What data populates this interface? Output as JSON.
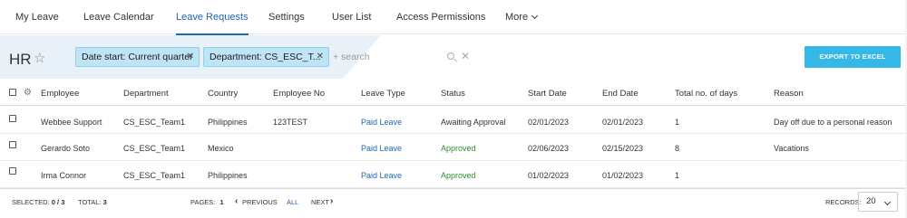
{
  "nav": {
    "items": [
      "My Leave",
      "Leave Calendar",
      "Leave Requests",
      "Settings",
      "User List",
      "Access Permissions"
    ],
    "more_label": "More",
    "active": "Leave Requests"
  },
  "header": {
    "title": "HR",
    "filters": [
      "Date start: Current quarter",
      "Department: CS_ESC_T..."
    ],
    "search_placeholder": "+ search",
    "export_label": "EXPORT TO EXCEL"
  },
  "table": {
    "columns": [
      "Employee",
      "Department",
      "Country",
      "Employee No",
      "Leave Type",
      "Status",
      "Start Date",
      "End Date",
      "Total no. of days",
      "Reason"
    ],
    "rows": [
      {
        "employee": "Webbee Support",
        "department": "CS_ESC_Team1",
        "country": "Philippines",
        "employee_no": "123TEST",
        "leave_type": "Paid Leave",
        "status": "Awaiting Approval",
        "start": "02/01/2023",
        "end": "02/01/2023",
        "days": "1",
        "reason": "Day off due to a personal reason"
      },
      {
        "employee": "Gerardo Soto",
        "department": "CS_ESC_Team1",
        "country": "Mexico",
        "employee_no": "",
        "leave_type": "Paid Leave",
        "status": "Approved",
        "start": "02/06/2023",
        "end": "02/15/2023",
        "days": "8",
        "reason": "Vacations"
      },
      {
        "employee": "Irma Connor",
        "department": "CS_ESC_Team1",
        "country": "Philippines",
        "employee_no": "",
        "leave_type": "Paid Leave",
        "status": "Approved",
        "start": "01/02/2023",
        "end": "01/02/2023",
        "days": "1",
        "reason": ""
      }
    ]
  },
  "footer": {
    "selected_label": "SELECTED:",
    "selected_value": "0 / 3",
    "total_label": "TOTAL:",
    "total_value": "3",
    "pages_label": "PAGES:",
    "pages_value": "1",
    "previous_label": "PREVIOUS",
    "all_label": "ALL",
    "next_label": "NEXT",
    "records_label": "RECORDS:",
    "records_value": "20"
  },
  "colors": {
    "accent": "#2067b0",
    "export": "#35b8e8",
    "chip": "#bfe4f6",
    "approved": "#2e8b2e"
  }
}
